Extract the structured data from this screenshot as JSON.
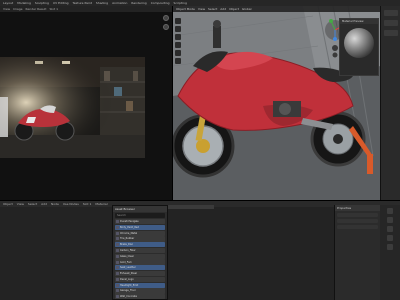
{
  "menubar": {
    "items": [
      "Layout",
      "Modeling",
      "Sculpting",
      "UV Editing",
      "Texture Paint",
      "Shading",
      "Animation",
      "Rendering",
      "Compositing",
      "Scripting"
    ]
  },
  "render_view": {
    "header": [
      "View",
      "Image",
      "Render Result",
      "Slot 1"
    ]
  },
  "viewport": {
    "header": [
      "Object Mode",
      "View",
      "Select",
      "Add",
      "Object",
      "Global"
    ]
  },
  "material_preview": {
    "title": "Material Preview"
  },
  "bottom": {
    "header": [
      "Object",
      "View",
      "Select",
      "Add",
      "Node",
      "Use Nodes",
      "Slot 1",
      "Material"
    ]
  },
  "catalog": {
    "title": "Asset Browser",
    "search_placeholder": "Search",
    "rows": [
      {
        "label": "Ducati Panigale",
        "value": "",
        "selected": false
      },
      {
        "label": "Body_Paint_Red",
        "value": "",
        "selected": true
      },
      {
        "label": "Chrome_Metal",
        "value": "",
        "selected": false
      },
      {
        "label": "Tire_Rubber",
        "value": "",
        "selected": false
      },
      {
        "label": "Brake_Disc",
        "value": "",
        "selected": true
      },
      {
        "label": "Carbon_Fiber",
        "value": "",
        "selected": false
      },
      {
        "label": "Glass_Clear",
        "value": "",
        "selected": false
      },
      {
        "label": "Gold_Fork",
        "value": "",
        "selected": false
      },
      {
        "label": "Seat_Leather",
        "value": "",
        "selected": true
      },
      {
        "label": "Exhaust_Steel",
        "value": "",
        "selected": false
      },
      {
        "label": "Decal_Logo",
        "value": "",
        "selected": false
      },
      {
        "label": "Headlight_Emit",
        "value": "",
        "selected": true
      },
      {
        "label": "Garage_Floor",
        "value": "",
        "selected": false
      },
      {
        "label": "Wall_Concrete",
        "value": "",
        "selected": false
      },
      {
        "label": "Lamp_Emission",
        "value": "",
        "selected": false
      }
    ]
  },
  "properties": {
    "title": "Properties"
  },
  "colors": {
    "accent": "#3f5c87",
    "bike_red": "#c0303a",
    "background": "#1d1d1d"
  }
}
